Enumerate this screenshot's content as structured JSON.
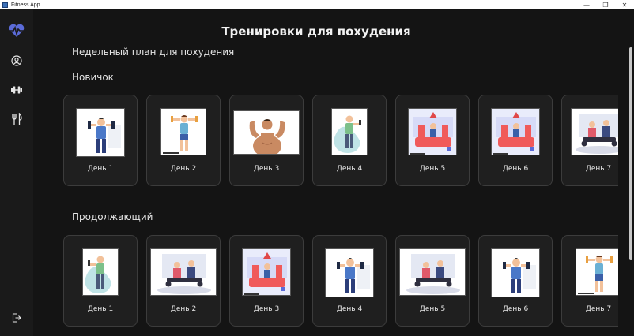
{
  "window": {
    "title": "Fitness App"
  },
  "sidebar": {
    "items": [
      {
        "icon": "heartbeat-logo-icon"
      },
      {
        "icon": "user-profile-icon"
      },
      {
        "icon": "dumbbell-icon"
      },
      {
        "icon": "fork-knife-icon"
      },
      {
        "icon": "logout-icon"
      }
    ]
  },
  "page": {
    "title": "Тренировки для похудения",
    "subtitle": "Недельный план для похудения"
  },
  "levels": [
    {
      "title": "Новичок",
      "days": [
        "День 1",
        "День 2",
        "День 3",
        "День 4",
        "День 5",
        "День 6",
        "День 7"
      ]
    },
    {
      "title": "Продолжающий",
      "days": [
        "День 1",
        "День 2",
        "День 3",
        "День 4",
        "День 5",
        "День 6",
        "День 7"
      ]
    }
  ],
  "colors": {
    "accent": "#5b6bd8",
    "background": "#141414",
    "card": "#1f1f1f"
  }
}
